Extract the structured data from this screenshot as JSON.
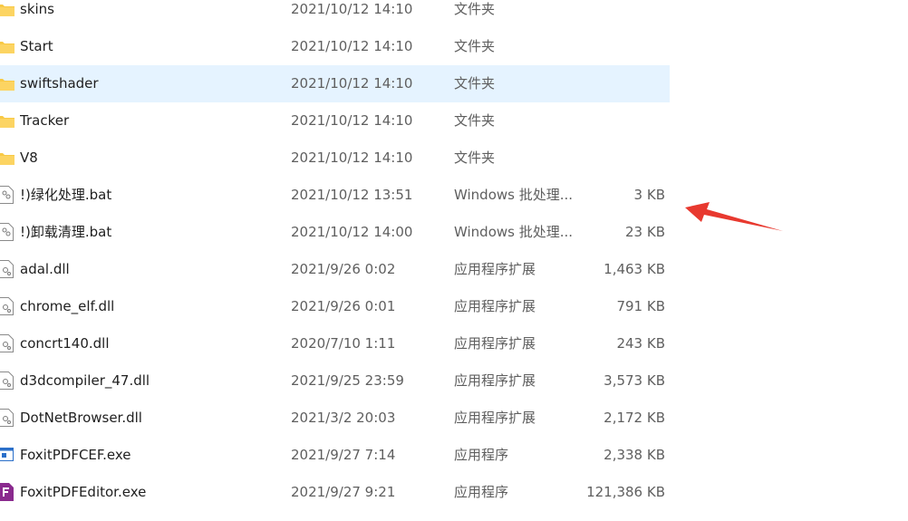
{
  "files": [
    {
      "name": "skins",
      "date": "2021/10/12 14:10",
      "type": "文件夹",
      "size": "",
      "icon": "folder-icon"
    },
    {
      "name": "Start",
      "date": "2021/10/12 14:10",
      "type": "文件夹",
      "size": "",
      "icon": "folder-icon"
    },
    {
      "name": "swiftshader",
      "date": "2021/10/12 14:10",
      "type": "文件夹",
      "size": "",
      "icon": "folder-icon"
    },
    {
      "name": "Tracker",
      "date": "2021/10/12 14:10",
      "type": "文件夹",
      "size": "",
      "icon": "folder-icon"
    },
    {
      "name": "V8",
      "date": "2021/10/12 14:10",
      "type": "文件夹",
      "size": "",
      "icon": "folder-icon"
    },
    {
      "name": "!)绿化处理.bat",
      "date": "2021/10/12 13:51",
      "type": "Windows 批处理...",
      "size": "3 KB",
      "icon": "batch-file-icon"
    },
    {
      "name": "!)卸载清理.bat",
      "date": "2021/10/12 14:00",
      "type": "Windows 批处理...",
      "size": "23 KB",
      "icon": "batch-file-icon"
    },
    {
      "name": "adal.dll",
      "date": "2021/9/26 0:02",
      "type": "应用程序扩展",
      "size": "1,463 KB",
      "icon": "dll-file-icon"
    },
    {
      "name": "chrome_elf.dll",
      "date": "2021/9/26 0:01",
      "type": "应用程序扩展",
      "size": "791 KB",
      "icon": "dll-file-icon"
    },
    {
      "name": "concrt140.dll",
      "date": "2020/7/10 1:11",
      "type": "应用程序扩展",
      "size": "243 KB",
      "icon": "dll-file-icon"
    },
    {
      "name": "d3dcompiler_47.dll",
      "date": "2021/9/25 23:59",
      "type": "应用程序扩展",
      "size": "3,573 KB",
      "icon": "dll-file-icon"
    },
    {
      "name": "DotNetBrowser.dll",
      "date": "2021/3/2 20:03",
      "type": "应用程序扩展",
      "size": "2,172 KB",
      "icon": "dll-file-icon"
    },
    {
      "name": "FoxitPDFCEF.exe",
      "date": "2021/9/27 7:14",
      "type": "应用程序",
      "size": "2,338 KB",
      "icon": "application-icon"
    },
    {
      "name": "FoxitPDFEditor.exe",
      "date": "2021/9/27 9:21",
      "type": "应用程序",
      "size": "121,386 KB",
      "icon": "foxit-pdf-icon"
    }
  ],
  "colors": {
    "folder": "#f8c945",
    "selection": "#e5f3ff",
    "annotation_arrow": "#e8392f"
  }
}
